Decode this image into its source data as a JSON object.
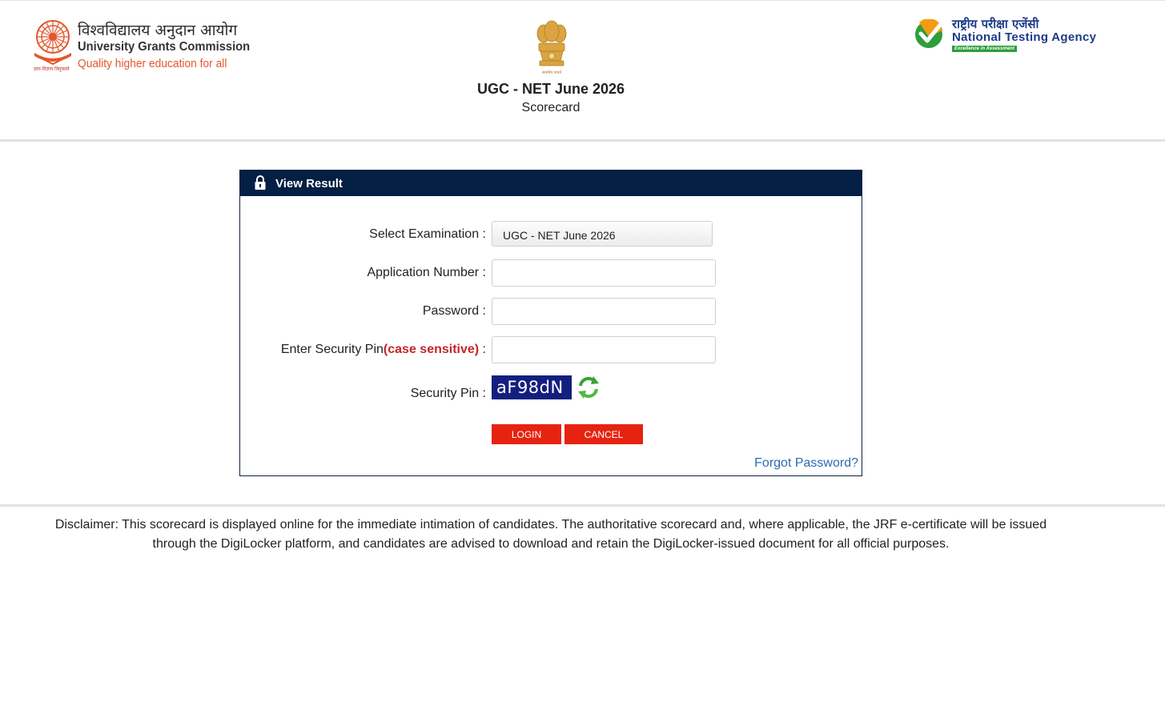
{
  "header": {
    "ugc": {
      "hindi": "विश्वविद्यालय अनुदान आयोग",
      "name": "University Grants Commission",
      "tagline": "Quality higher education for all",
      "small_hindi": "ज्ञान-विज्ञान विमुक्तये"
    },
    "emblem_caption": "सत्यमेव जयते",
    "title": "UGC - NET June 2026",
    "subtitle": "Scorecard",
    "nta": {
      "hindi": "राष्ट्रीय परीक्षा एजेंसी",
      "name": "National Testing Agency",
      "tagline": "Excellence in Assessment"
    }
  },
  "panel": {
    "title": "View Result",
    "lock_icon": "lock-icon",
    "fields": {
      "exam_label": "Select Examination :",
      "exam_value": "UGC - NET June 2026",
      "app_label": "Application Number :",
      "app_value": "",
      "password_label": "Password :",
      "password_value": "",
      "pin_label_prefix": "Enter Security Pin",
      "pin_label_highlight": "(case sensitive)",
      "pin_label_suffix": " :",
      "pin_value": "",
      "captcha_label": "Security Pin :",
      "captcha_text": "aF98dN"
    },
    "buttons": {
      "login": "LOGIN",
      "cancel": "CANCEL"
    },
    "forgot": "Forgot Password?"
  },
  "disclaimer": "Disclaimer: This scorecard is displayed online for the immediate intimation of candidates. The authoritative scorecard and, where applicable, the JRF e-certificate will be issued through the DigiLocker platform, and candidates are advised to download and retain the DigiLocker-issued document for all official purposes.",
  "colors": {
    "panel_header": "#041f44",
    "button": "#e62310",
    "captcha_bg": "#131f7f",
    "link": "#2b6bb0",
    "highlight_red": "#c0272d",
    "nta_blue": "#1d3b87",
    "ugc_orange": "#e4572e"
  }
}
